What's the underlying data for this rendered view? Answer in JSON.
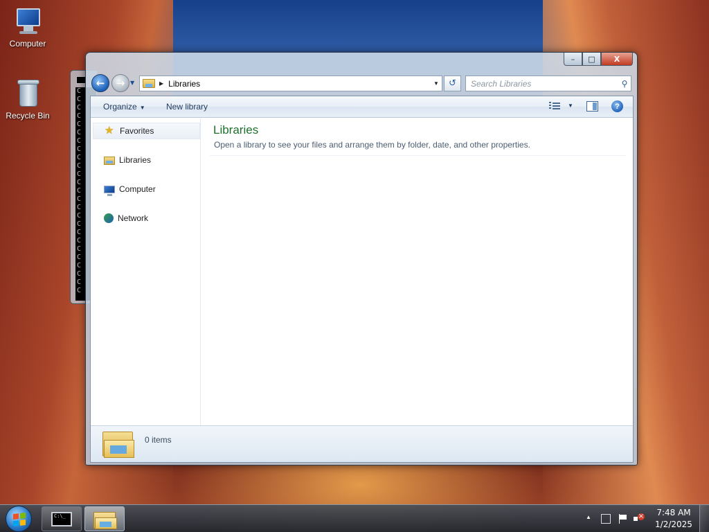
{
  "desktop": {
    "icons": [
      {
        "label": "Computer",
        "icon": "computer-icon"
      },
      {
        "label": "Recycle Bin",
        "icon": "recycle-bin-icon"
      }
    ]
  },
  "console": {
    "title_glyph": "C:\\",
    "prompt_char": "C"
  },
  "explorer": {
    "address": {
      "location": "Libraries",
      "folder_icon": "libraries-icon"
    },
    "search": {
      "placeholder": "Search Libraries"
    },
    "toolbar": {
      "organize_label": "Organize",
      "new_library_label": "New library"
    },
    "nav": {
      "items": [
        {
          "label": "Favorites",
          "icon": "star-icon",
          "selected": true
        },
        {
          "label": "Libraries",
          "icon": "libraries-icon"
        },
        {
          "label": "Computer",
          "icon": "computer-icon"
        },
        {
          "label": "Network",
          "icon": "network-icon"
        }
      ]
    },
    "main": {
      "title": "Libraries",
      "subtitle": "Open a library to see your files and arrange them by folder, date, and other properties."
    },
    "details": {
      "item_count": "0 items"
    },
    "caption": {
      "minimize": "–",
      "maximize": "□",
      "close": "X"
    },
    "accent_title_color": "#1e6f2b"
  },
  "taskbar": {
    "buttons": [
      {
        "name": "command-prompt",
        "glyph": "C:\\_"
      },
      {
        "name": "windows-explorer",
        "active": true
      }
    ],
    "clock": {
      "time": "7:48 AM",
      "date": "1/2/2025"
    }
  }
}
